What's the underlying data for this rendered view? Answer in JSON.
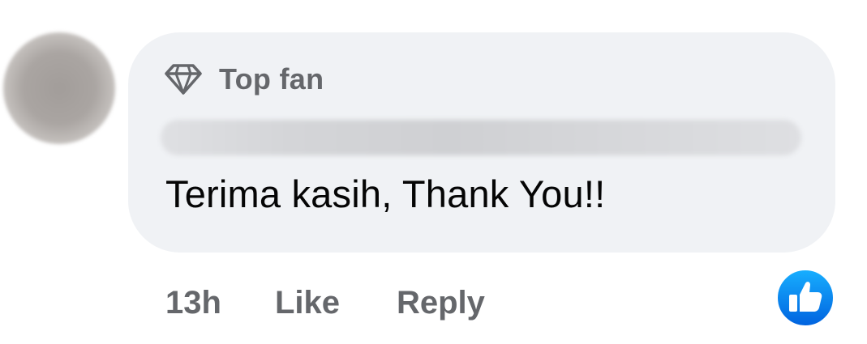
{
  "comment": {
    "badge_icon": "diamond-icon",
    "badge_label": "Top fan",
    "text": "Terima kasih, Thank You!!",
    "accent_color": "#1877f2",
    "bubble_color": "#f0f2f5"
  },
  "actions": {
    "timestamp": "13h",
    "like_label": "Like",
    "reply_label": "Reply"
  },
  "reaction": {
    "icon": "thumbs-up-icon"
  }
}
